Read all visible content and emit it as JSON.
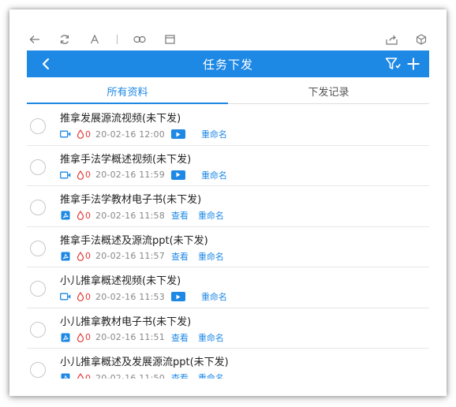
{
  "header": {
    "title": "任务下发"
  },
  "tabs": [
    {
      "label": "所有资料",
      "active": true
    },
    {
      "label": "下发记录",
      "active": false
    }
  ],
  "colors": {
    "primary": "#1e88e5",
    "count_red": "#e53935",
    "date_gray": "#888888"
  },
  "rename_label": "重命名",
  "view_label": "查看",
  "items": [
    {
      "name": "推拿发展源流视频(未下发)",
      "type": "video",
      "count": "0",
      "date": "20-02-16 12:00"
    },
    {
      "name": "推拿手法学概述视频(未下发)",
      "type": "video",
      "count": "0",
      "date": "20-02-16 11:59"
    },
    {
      "name": "推拿手法学教材电子书(未下发)",
      "type": "pdf",
      "count": "0",
      "date": "20-02-16 11:58"
    },
    {
      "name": "推拿手法概述及源流ppt(未下发)",
      "type": "pdf",
      "count": "0",
      "date": "20-02-16 11:57"
    },
    {
      "name": "小儿推拿概述视频(未下发)",
      "type": "video",
      "count": "0",
      "date": "20-02-16 11:53"
    },
    {
      "name": "小儿推拿教材电子书(未下发)",
      "type": "pdf",
      "count": "0",
      "date": "20-02-16 11:51"
    },
    {
      "name": "小儿推拿概述及发展源流ppt(未下发)",
      "type": "pdf",
      "count": "0",
      "date": "20-02-16 11:50"
    }
  ]
}
